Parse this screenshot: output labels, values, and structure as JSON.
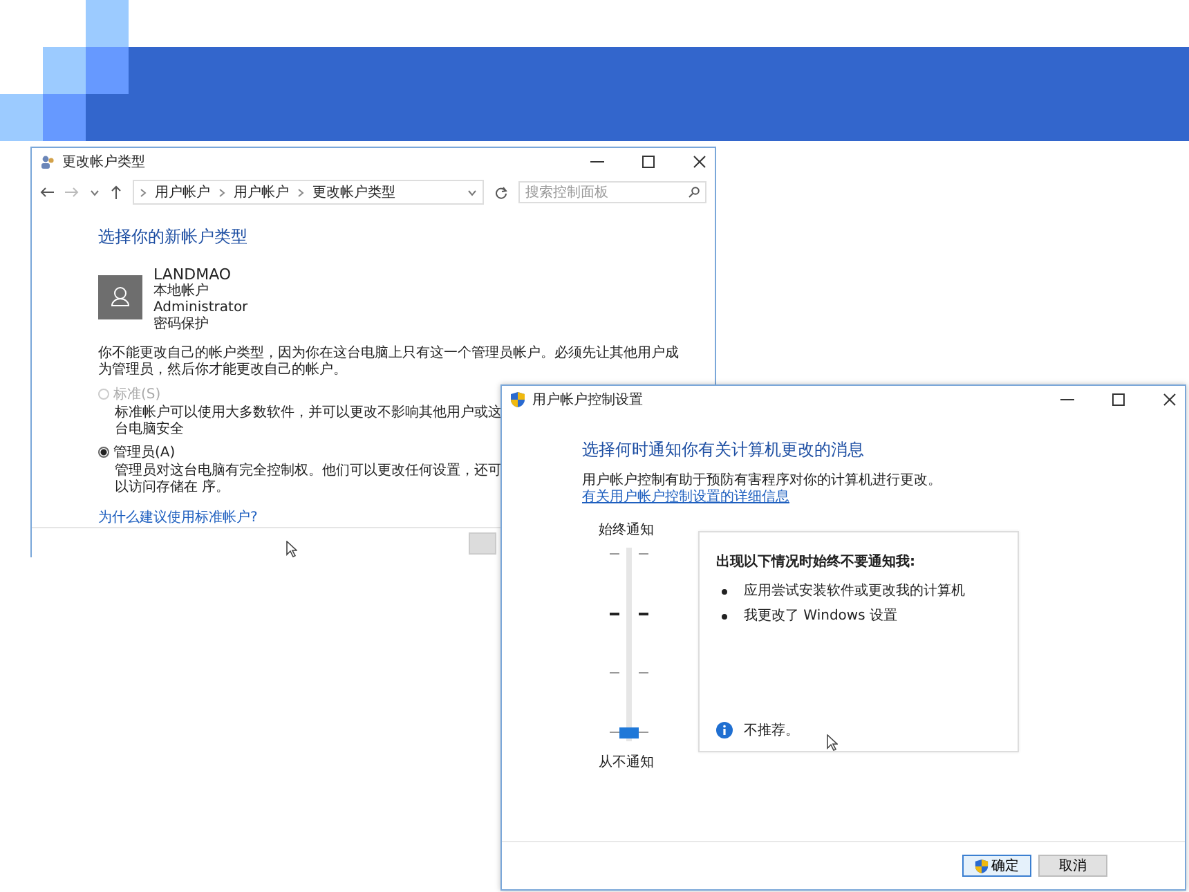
{
  "account_window": {
    "title": "更改帐户类型",
    "breadcrumb": [
      "用户帐户",
      "用户帐户",
      "更改帐户类型"
    ],
    "search": {
      "placeholder": "搜索控制面板"
    },
    "heading": "选择你的新帐户类型",
    "account": {
      "name": "LANDMAO",
      "lines": [
        "本地帐户",
        "Administrator",
        "密码保护"
      ]
    },
    "notice": "你不能更改自己的帐户类型，因为你在这台电脑上只有这一个管理员帐户。必须先让其他用户成为管理员，然后你才能更改自己的帐户。",
    "options": [
      {
        "label": "标准(S)",
        "description": "标准帐户可以使用大多数软件，并可以更改不影响其他用户或这台电脑安全",
        "selected": false,
        "disabled": true
      },
      {
        "label": "管理员(A)",
        "description": "管理员对这台电脑有完全控制权。他们可以更改任何设置，还可以访问存储在 序。",
        "selected": true,
        "disabled": false
      }
    ],
    "link": "为什么建议使用标准帐户?"
  },
  "uac_window": {
    "title": "用户帐户控制设置",
    "heading": "选择何时通知你有关计算机更改的消息",
    "description": "用户帐户控制有助于预防有害程序对你的计算机进行更改。",
    "link": "有关用户帐户控制设置的详细信息",
    "slider": {
      "top_label": "始终通知",
      "bottom_label": "从不通知",
      "level": 0
    },
    "info": {
      "heading": "出现以下情况时始终不要通知我:",
      "bullets": [
        "应用尝试安装软件或更改我的计算机",
        "我更改了 Windows 设置"
      ],
      "note": "不推荐。"
    },
    "buttons": [
      {
        "label": "确定",
        "kind": "primary"
      },
      {
        "label": "取消",
        "kind": "default"
      }
    ]
  }
}
